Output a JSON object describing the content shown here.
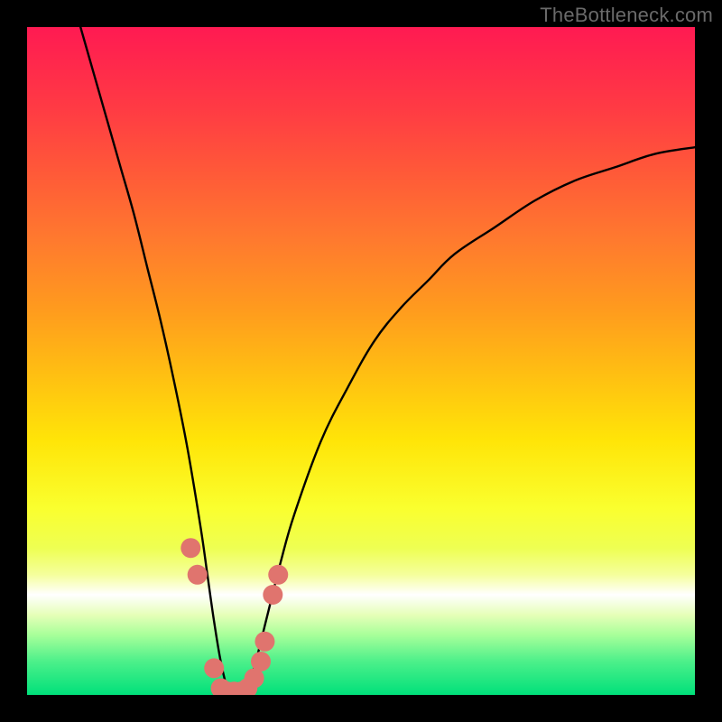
{
  "watermark": "TheBottleneck.com",
  "chart_data": {
    "type": "line",
    "title": "",
    "xlabel": "",
    "ylabel": "",
    "xlim": [
      0,
      100
    ],
    "ylim": [
      0,
      100
    ],
    "grid": false,
    "series": [
      {
        "name": "bottleneck-curve",
        "x": [
          8,
          10,
          12,
          14,
          16,
          18,
          20,
          22,
          24,
          26,
          27,
          28,
          29,
          30,
          31,
          32,
          33,
          34,
          36,
          38,
          40,
          44,
          48,
          52,
          56,
          60,
          64,
          70,
          76,
          82,
          88,
          94,
          100
        ],
        "values": [
          100,
          93,
          86,
          79,
          72,
          64,
          56,
          47,
          37,
          25,
          18,
          11,
          5,
          1,
          0,
          0,
          1,
          4,
          12,
          20,
          27,
          38,
          46,
          53,
          58,
          62,
          66,
          70,
          74,
          77,
          79,
          81,
          82
        ]
      }
    ],
    "markers": {
      "name": "highlighted-points",
      "color": "#e0746e",
      "points": [
        {
          "x": 24.5,
          "y": 22
        },
        {
          "x": 25.5,
          "y": 18
        },
        {
          "x": 28.0,
          "y": 4
        },
        {
          "x": 29.0,
          "y": 1
        },
        {
          "x": 30.0,
          "y": 0.5
        },
        {
          "x": 31.0,
          "y": 0.5
        },
        {
          "x": 32.0,
          "y": 0.5
        },
        {
          "x": 33.0,
          "y": 1
        },
        {
          "x": 34.0,
          "y": 2.5
        },
        {
          "x": 35.0,
          "y": 5
        },
        {
          "x": 35.6,
          "y": 8
        },
        {
          "x": 36.8,
          "y": 15
        },
        {
          "x": 37.6,
          "y": 18
        }
      ]
    },
    "background_gradient": {
      "top": "#ff1a52",
      "upper_mid": "#ffbf12",
      "lower_mid": "#faff2e",
      "white_band": "#ffffff",
      "bottom": "#00e07a"
    }
  }
}
